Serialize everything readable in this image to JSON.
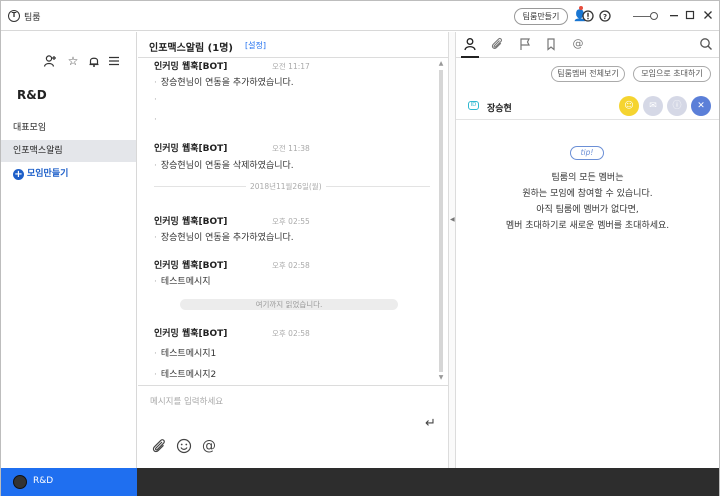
{
  "app": {
    "title": "팀룸",
    "logo_glyph": "T"
  },
  "titlebar": {
    "make_team_label": "팀룸만들기",
    "icons": [
      "person-add-icon",
      "notice-icon",
      "help-icon",
      "zoom-slider",
      "minimize-icon",
      "maximize-icon",
      "close-icon"
    ]
  },
  "sidebar": {
    "team_name": "R&D",
    "rooms": [
      {
        "label": "대표모임",
        "active": false
      },
      {
        "label": "인포맥스알림",
        "active": true
      }
    ],
    "add_room_label": "모임만들기"
  },
  "bottom": {
    "team_label": "R&D"
  },
  "chat": {
    "room_title": "인포맥스알림 (1명)",
    "setting_label": "[설정]",
    "messages": [
      {
        "sender": "인커밍 웹훅[BOT]",
        "time": "오전 11:17",
        "lines": [
          "장승현님이 연동을 추가하였습니다.",
          "",
          ""
        ]
      },
      {
        "sender": "인커밍 웹훅[BOT]",
        "time": "오전 11:38",
        "lines": [
          "장승현님이 연동을 삭제하였습니다."
        ]
      },
      {
        "sender": "인커밍 웹훅[BOT]",
        "time": "오후 02:55",
        "lines": [
          "장승현님이 연동을 추가하였습니다."
        ]
      },
      {
        "sender": "인커밍 웹훅[BOT]",
        "time": "오후 02:58",
        "lines": [
          "테스트메시지"
        ]
      },
      {
        "sender": "인커밍 웹훅[BOT]",
        "time": "오후 02:58",
        "lines": [
          "테스트메시지1",
          "테스트메시지2"
        ]
      }
    ],
    "date_divider": "2018년11월26일(월)",
    "read_marker": "여기까지 읽었습니다.",
    "input_placeholder": "메시지를 입력하세요"
  },
  "right_panel": {
    "all_members_label": "팀룸멤버 전체보기",
    "invite_label": "모임으로 초대하기",
    "member": {
      "badge": "ID",
      "name": "장승현"
    },
    "member_actions": [
      {
        "name": "chat-action",
        "color": "#f5d430",
        "glyph": "☺"
      },
      {
        "name": "mail-action",
        "color": "#d5d8e6",
        "glyph": "✉"
      },
      {
        "name": "profile-action",
        "color": "#d5d8e6",
        "glyph": "ⓘ"
      },
      {
        "name": "remove-action",
        "color": "#5b7fd8",
        "glyph": "✕"
      }
    ],
    "tip_label": "tip!",
    "tip_lines": [
      "팀룸의 모든 멤버는",
      "원하는 모임에 참여할 수 있습니다.",
      "아직 팀룸에 멤버가 없다면,",
      "멤버 초대하기로 새로운 멤버를 초대하세요."
    ]
  }
}
